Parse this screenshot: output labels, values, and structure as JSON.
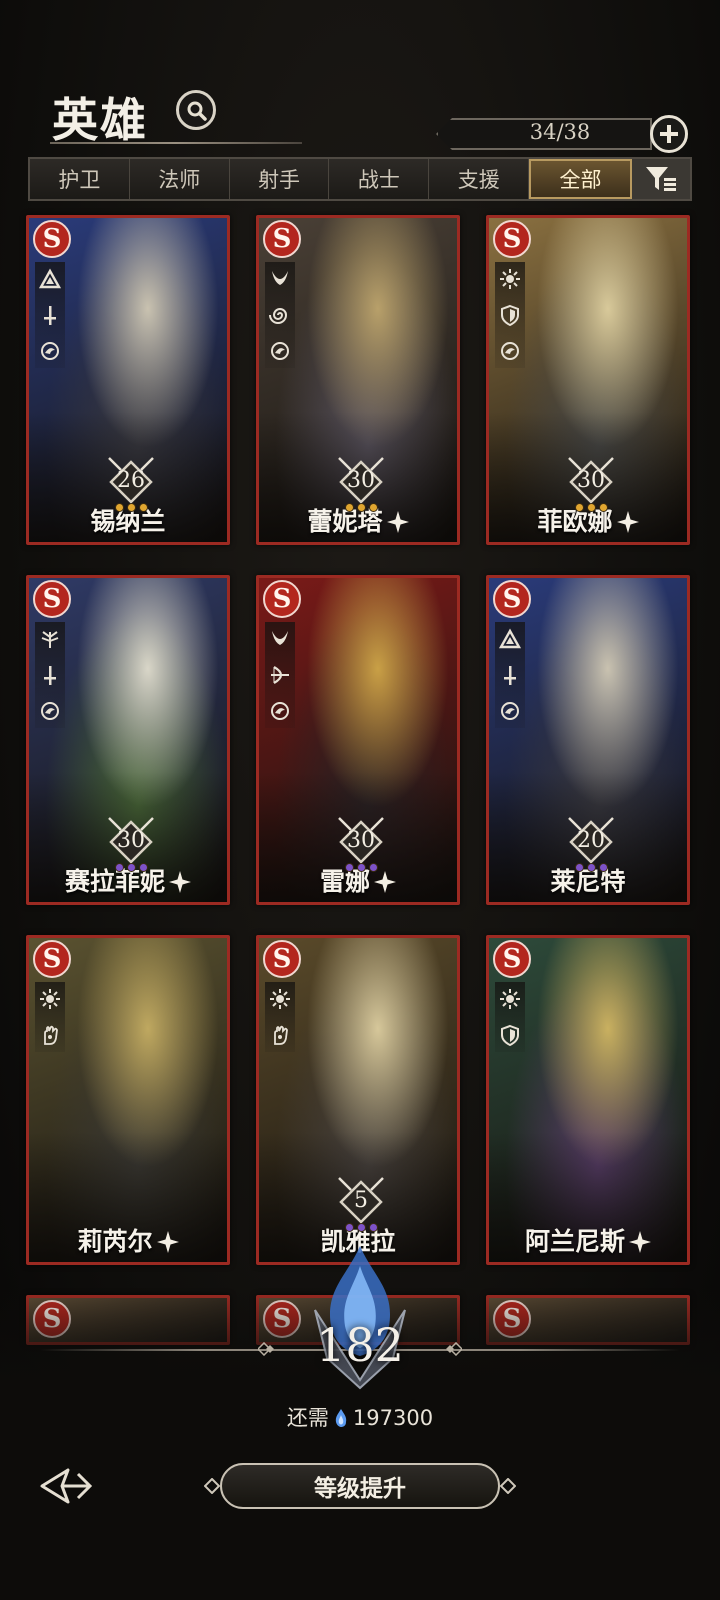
{
  "header": {
    "title": "英雄",
    "hero_count": "34/38"
  },
  "tabs": [
    {
      "label": "护卫",
      "active": false
    },
    {
      "label": "法师",
      "active": false
    },
    {
      "label": "射手",
      "active": false
    },
    {
      "label": "战士",
      "active": false
    },
    {
      "label": "支援",
      "active": false
    },
    {
      "label": "全部",
      "active": true
    }
  ],
  "heroes": [
    {
      "name": "锡纳兰",
      "rank": "S",
      "level": "26",
      "sparkle": false,
      "stars": 3,
      "star_color": "gold",
      "icons": [
        "triangle-rune-icon",
        "dagger-icon",
        "dragon-icon"
      ],
      "palette": [
        "#2a3b7a",
        "#c9c2b0",
        "#3a3a42"
      ]
    },
    {
      "name": "蕾妮塔",
      "rank": "S",
      "level": "30",
      "sparkle": true,
      "stars": 3,
      "star_color": "gold",
      "icons": [
        "horned-moon-icon",
        "spiral-icon",
        "dragon-icon"
      ],
      "palette": [
        "#4a4036",
        "#b8a06a",
        "#5b5560"
      ]
    },
    {
      "name": "菲欧娜",
      "rank": "S",
      "level": "30",
      "sparkle": true,
      "stars": 3,
      "star_color": "gold",
      "icons": [
        "sun-icon",
        "shield-icon",
        "dragon-icon"
      ],
      "palette": [
        "#8a7040",
        "#d8c99a",
        "#4a4a48"
      ]
    },
    {
      "name": "赛拉菲妮",
      "rank": "S",
      "level": "30",
      "sparkle": true,
      "stars": 3,
      "star_color": "purple",
      "icons": [
        "tree-icon",
        "dagger-icon",
        "dragon-icon"
      ],
      "palette": [
        "#2f3a66",
        "#d9d6c8",
        "#4b6a3a"
      ]
    },
    {
      "name": "雷娜",
      "rank": "S",
      "level": "30",
      "sparkle": true,
      "stars": 3,
      "star_color": "purple",
      "icons": [
        "horned-moon-icon",
        "bow-icon",
        "dragon-icon"
      ],
      "palette": [
        "#7a1a18",
        "#c9a046",
        "#2b2224"
      ]
    },
    {
      "name": "莱尼特",
      "rank": "S",
      "level": "20",
      "sparkle": false,
      "stars": 3,
      "star_color": "purple",
      "icons": [
        "triangle-rune-icon",
        "dagger-icon",
        "dragon-icon"
      ],
      "palette": [
        "#2a3b7a",
        "#c9c2b0",
        "#3a3a42"
      ]
    },
    {
      "name": "莉芮尔",
      "rank": "S",
      "level": "",
      "sparkle": true,
      "stars": 0,
      "star_color": "gold",
      "icons": [
        "sun-icon",
        "hand-icon"
      ],
      "palette": [
        "#5a5230",
        "#bfa860",
        "#3c3a34"
      ]
    },
    {
      "name": "凯雅拉",
      "rank": "S",
      "level": "5",
      "sparkle": false,
      "stars": 3,
      "star_color": "purple",
      "icons": [
        "sun-icon",
        "hand-icon"
      ],
      "palette": [
        "#5a4a2a",
        "#d6c79a",
        "#4a4440"
      ]
    },
    {
      "name": "阿兰尼斯",
      "rank": "S",
      "level": "",
      "sparkle": true,
      "stars": 0,
      "star_color": "gold",
      "icons": [
        "sun-icon",
        "shield-icon"
      ],
      "palette": [
        "#2d4a3a",
        "#c9b060",
        "#5a3f6a"
      ]
    }
  ],
  "partial_cards": [
    {
      "rank": "S"
    },
    {
      "rank": "S"
    },
    {
      "rank": "S"
    }
  ],
  "footer": {
    "level": "182",
    "cost_label": "还需",
    "cost_value": "197300",
    "upgrade_label": "等级提升"
  },
  "colors": {
    "card_border": "#9c2a22",
    "rank_badge": "#b3261e",
    "active_tab": "#6b5530",
    "flame": "#4f8de0"
  }
}
